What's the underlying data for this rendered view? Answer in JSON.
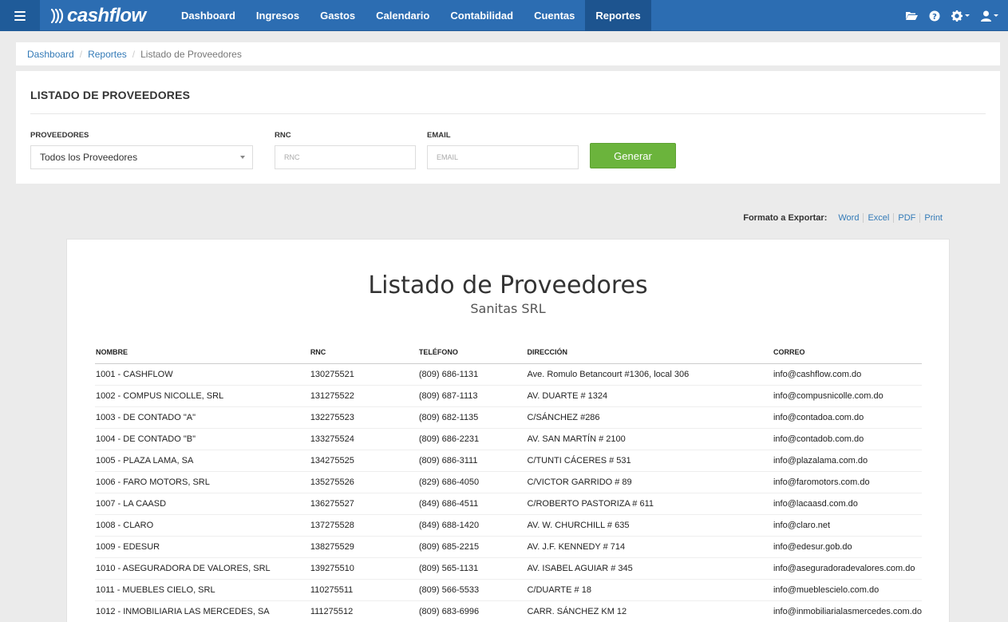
{
  "navbar": {
    "brand": "cashflow",
    "items": [
      {
        "label": "Dashboard",
        "active": false
      },
      {
        "label": "Ingresos",
        "active": false
      },
      {
        "label": "Gastos",
        "active": false
      },
      {
        "label": "Calendario",
        "active": false
      },
      {
        "label": "Contabilidad",
        "active": false
      },
      {
        "label": "Cuentas",
        "active": false
      },
      {
        "label": "Reportes",
        "active": true
      }
    ],
    "icons": [
      "folder-open-icon",
      "help-icon",
      "gear-icon",
      "user-icon"
    ]
  },
  "breadcrumb": {
    "items": [
      "Dashboard",
      "Reportes"
    ],
    "current": "Listado de Proveedores"
  },
  "filters": {
    "title": "LISTADO DE PROVEEDORES",
    "proveedores_label": "PROVEEDORES",
    "proveedores_value": "Todos los Proveedores",
    "rnc_label": "RNC",
    "rnc_placeholder": "RNC",
    "email_label": "EMAIL",
    "email_placeholder": "EMAIL",
    "generate_label": "Generar"
  },
  "export": {
    "label": "Formato a Exportar:",
    "formats": [
      "Word",
      "Excel",
      "PDF",
      "Print"
    ]
  },
  "report": {
    "title": "Listado de Proveedores",
    "subtitle": "Sanitas SRL",
    "columns": [
      "NOMBRE",
      "RNC",
      "TELÉFONO",
      "DIRECCIÓN",
      "CORREO"
    ],
    "rows": [
      [
        "1001 - CASHFLOW",
        "130275521",
        "(809) 686-1131",
        "Ave. Romulo Betancourt #1306, local 306",
        "info@cashflow.com.do"
      ],
      [
        "1002 - COMPUS NICOLLE, SRL",
        "131275522",
        "(809) 687-1113",
        "AV. DUARTE # 1324",
        "info@compusnicolle.com.do"
      ],
      [
        "1003 - DE CONTADO \"A\"",
        "132275523",
        "(809) 682-1135",
        "C/SÁNCHEZ #286",
        "info@contadoa.com.do"
      ],
      [
        "1004 - DE CONTADO \"B\"",
        "133275524",
        "(809) 686-2231",
        "AV. SAN MARTÍN # 2100",
        "info@contadob.com.do"
      ],
      [
        "1005 - PLAZA LAMA, SA",
        "134275525",
        "(809) 686-3111",
        "C/TUNTI CÁCERES # 531",
        "info@plazalama.com.do"
      ],
      [
        "1006 - FARO MOTORS, SRL",
        "135275526",
        "(829) 686-4050",
        "C/VICTOR GARRIDO # 89",
        "info@faromotors.com.do"
      ],
      [
        "1007 - LA CAASD",
        "136275527",
        "(849) 686-4511",
        "C/ROBERTO PASTORIZA # 611",
        "info@lacaasd.com.do"
      ],
      [
        "1008 - CLARO",
        "137275528",
        "(849) 688-1420",
        "AV. W. CHURCHILL # 635",
        "info@claro.net"
      ],
      [
        "1009 - EDESUR",
        "138275529",
        "(809) 685-2215",
        "AV. J.F. KENNEDY # 714",
        "info@edesur.gob.do"
      ],
      [
        "1010 - ASEGURADORA DE VALORES, SRL",
        "139275510",
        "(809) 565-1131",
        "AV. ISABEL AGUIAR # 345",
        "info@aseguradoradevalores.com.do"
      ],
      [
        "1011 - MUEBLES CIELO, SRL",
        "110275511",
        "(809) 566-5533",
        "C/DUARTE # 18",
        "info@mueblescielo.com.do"
      ],
      [
        "1012 - INMOBILIARIA LAS MERCEDES, SA",
        "111275512",
        "(809) 683-6996",
        "CARR. SÁNCHEZ KM 12",
        "info@inmobiliarialasmercedes.com.do"
      ]
    ]
  },
  "colors": {
    "navbar": "#2c6db2",
    "navbar_active": "#1d548f",
    "link": "#337ab7",
    "button_green": "#6bb43c",
    "background": "#ebebeb"
  }
}
